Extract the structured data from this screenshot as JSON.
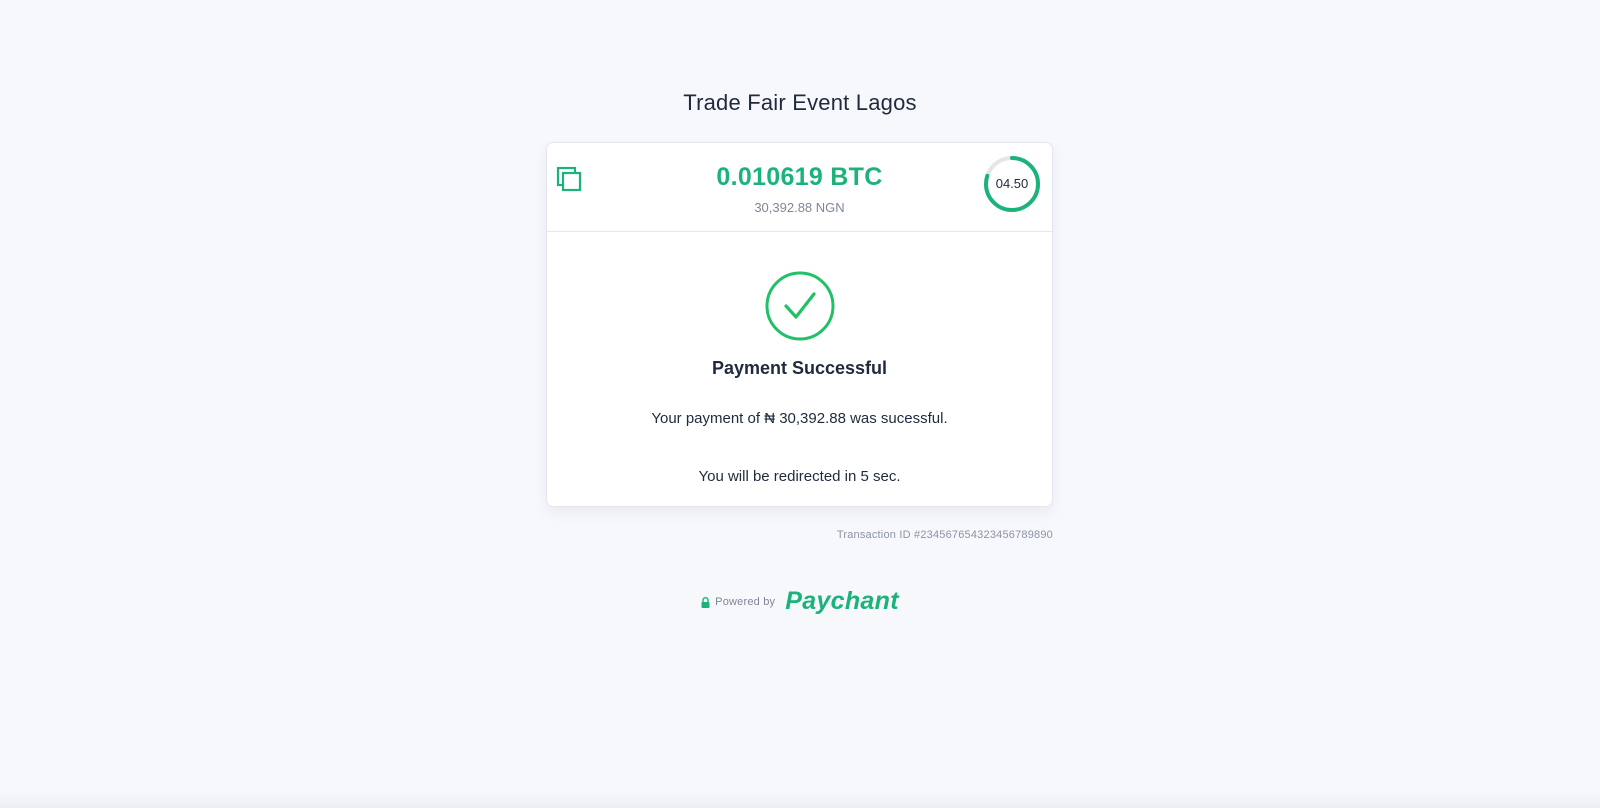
{
  "event": {
    "title": "Trade Fair Event Lagos"
  },
  "payment": {
    "crypto_amount": "0.010619 BTC",
    "fiat_amount": "30,392.88 NGN",
    "timer": {
      "label": "04.50",
      "progress": 0.8
    },
    "status_title": "Payment Successful",
    "message": "Your payment of ₦ 30,392.88 was sucessful.",
    "redirect_message": "You will be redirected in 5 sec."
  },
  "transaction": {
    "label": "Transaction ID #2345676543234567898​90"
  },
  "footer": {
    "powered_by": "Powered by",
    "brand": "Paychant"
  },
  "icons": {
    "copy": "copy-icon",
    "check": "check-circle-icon",
    "lock": "lock-icon"
  },
  "colors": {
    "accent": "#1bb37a",
    "success": "#22c067",
    "text": "#1f2a3d",
    "muted": "#7e8798",
    "background": "#f7f8fc"
  }
}
